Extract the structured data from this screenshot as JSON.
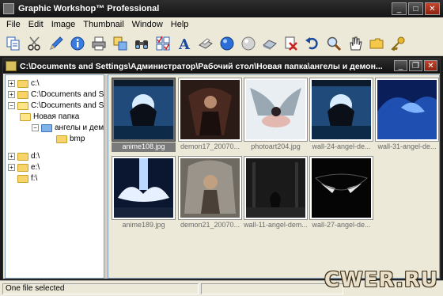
{
  "window": {
    "title": "Graphic Workshop™ Professional",
    "controls": [
      "minimize",
      "maximize",
      "close"
    ]
  },
  "menu": [
    "File",
    "Edit",
    "Image",
    "Thumbnail",
    "Window",
    "Help"
  ],
  "toolbar": {
    "icons": [
      "copy-icon",
      "cut-icon",
      "pen-icon",
      "info-icon",
      "print-icon",
      "duplicate-icon",
      "binoculars-icon",
      "checklist-icon",
      "text-icon",
      "scanner-icon",
      "blue-orb-icon",
      "gray-orb-icon",
      "eraser-icon",
      "delete-icon",
      "undo-icon",
      "zoom-icon",
      "hand-icon",
      "folder-icon",
      "key-icon"
    ]
  },
  "document": {
    "path": "C:\\Documents and Settings\\Администратор\\Рабочий стол\\Новая папка\\ангелы и демон..."
  },
  "tree": {
    "nodes": [
      {
        "label": "c:\\",
        "expander": "+",
        "indent": 0
      },
      {
        "label": "C:\\Documents and Set",
        "expander": "+",
        "indent": 0
      },
      {
        "label": "C:\\Documents and Se",
        "expander": "−",
        "indent": 0
      },
      {
        "label": "Новая папка",
        "expander": "",
        "indent": 1
      },
      {
        "label": "ангелы и демо",
        "expander": "−",
        "indent": 2
      },
      {
        "label": "bmp",
        "expander": "",
        "indent": 3
      },
      {
        "label": "d:\\",
        "expander": "+",
        "indent": 0
      },
      {
        "label": "e:\\",
        "expander": "+",
        "indent": 0
      },
      {
        "label": "f:\\",
        "expander": "",
        "indent": 0
      }
    ]
  },
  "thumbnails": [
    {
      "caption": "anime108.jpg",
      "selected": true
    },
    {
      "caption": "demon17_20070...",
      "selected": false
    },
    {
      "caption": "photoart204.jpg",
      "selected": false
    },
    {
      "caption": "wall-24-angel-de...",
      "selected": false
    },
    {
      "caption": "wall-31-angel-de...",
      "selected": false
    },
    {
      "caption": "anime189.jpg",
      "selected": false
    },
    {
      "caption": "demon21_20070...",
      "selected": false
    },
    {
      "caption": "wall-11-angel-dem...",
      "selected": false
    },
    {
      "caption": "wall-27-angel-de...",
      "selected": false
    }
  ],
  "status": {
    "text": "One file selected"
  },
  "watermark": "CWER.RU",
  "colors": {
    "titlebar": "#1a1a1a",
    "chrome": "#ece9d8",
    "selected_thumb": "#6b6b6b"
  }
}
